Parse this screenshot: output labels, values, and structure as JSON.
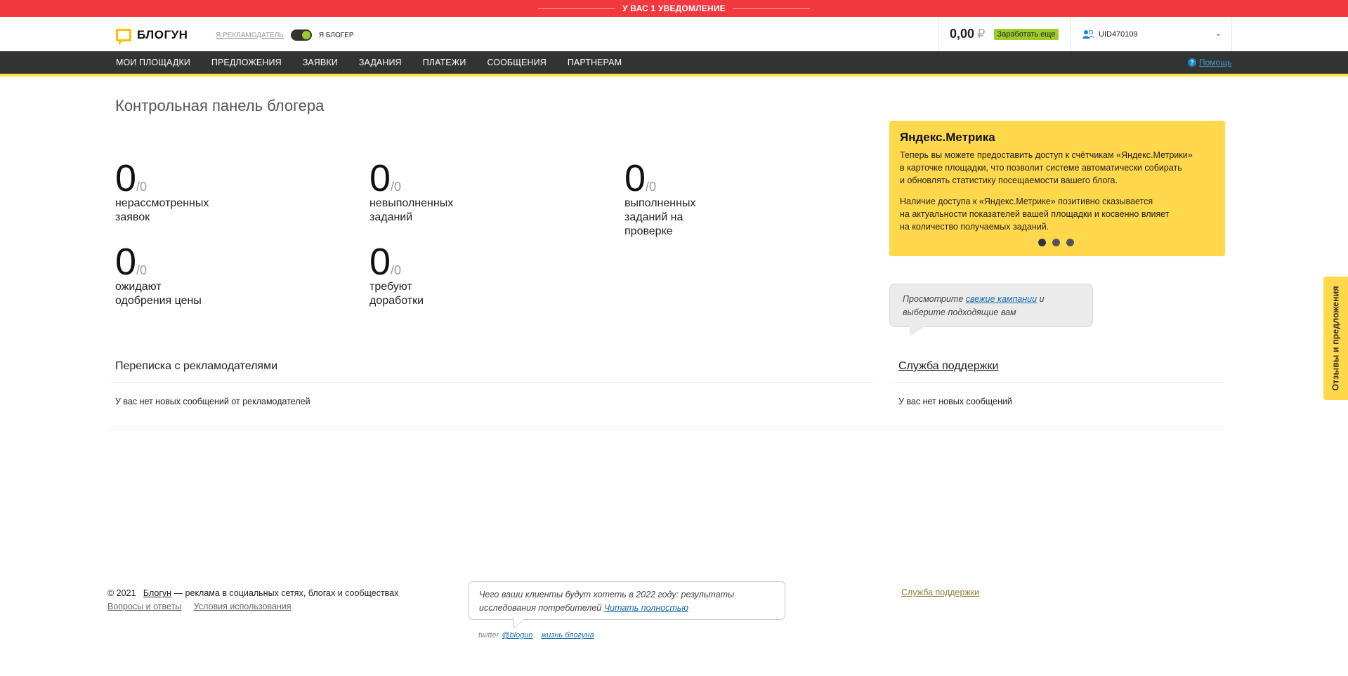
{
  "notification": {
    "text": "У ВАС 1 УВЕДОМЛЕНИЕ"
  },
  "header": {
    "logo_text": "БЛОГУН",
    "role_advertiser": "Я РЕКЛАМОДАТЕЛЬ",
    "role_blogger": "Я БЛОГЕР",
    "balance": "0,00",
    "currency": "₽",
    "earn_more": "Заработать еще",
    "user_id": "UID470109"
  },
  "nav": {
    "items": [
      "МОИ ПЛОЩАДКИ",
      "ПРЕДЛОЖЕНИЯ",
      "ЗАЯВКИ",
      "ЗАДАНИЯ",
      "ПЛАТЕЖИ",
      "СООБЩЕНИЯ",
      "ПАРТНЕРАМ"
    ],
    "help": "Помощь"
  },
  "main": {
    "title": "Контрольная панель блогера",
    "stats": [
      {
        "value": "0",
        "total": "/0",
        "label": "нерассмотренных заявок"
      },
      {
        "value": "0",
        "total": "/0",
        "label": "невыполненных заданий"
      },
      {
        "value": "0",
        "total": "/0",
        "label": "выполненных заданий на проверке"
      },
      {
        "value": "0",
        "total": "/0",
        "label": "ожидают одобрения цены"
      },
      {
        "value": "0",
        "total": "/0",
        "label": "требуют доработки"
      }
    ],
    "yandex": {
      "title": "Яндекс.Метрика",
      "p1": "Теперь вы можете предоставить доступ к счётчикам «Яндекс.Метрики»\nв карточке площадки, что позволит системе автоматически собирать\nи обновлять статистику посещаемости вашего блога.",
      "p2": "Наличие доступа к «Яндекс.Метрике» позитивно сказывается\nна актуальности показателей вашей площадки и косвенно влияет\nна количество получаемых заданий."
    },
    "campaigns": {
      "before": "Просмотрите ",
      "link": "свежие кампании",
      "after": " и",
      "line2": "выберите подходящие вам"
    },
    "correspondence": {
      "title": "Переписка с рекламодателями",
      "empty": "У вас нет новых сообщений от рекламодателей"
    },
    "support": {
      "title": "Служба поддержки",
      "empty": "У вас нет новых сообщений"
    }
  },
  "feedback_tab": "Отзывы и предложения",
  "footer": {
    "copyright": "© 2021",
    "brand_link": "Блогун",
    "tagline": " — реклама в социальных сетях, блогах и сообществах",
    "faq": "Вопросы и ответы",
    "terms": "Условия использования",
    "news_text": "Чего ваши клиенты будут хотеть в 2022 году: результаты исследования потребителей ",
    "news_link": "Читать полностью",
    "twitter_label": "twitter",
    "twitter_handle": "@blogun",
    "blog_link": "жизнь блогуна",
    "support": "Служба поддержки"
  },
  "colors": {
    "accent_red": "#f2393f",
    "accent_yellow": "#ffd84c",
    "nav_bg": "#333333",
    "green": "#9ccc2b"
  }
}
